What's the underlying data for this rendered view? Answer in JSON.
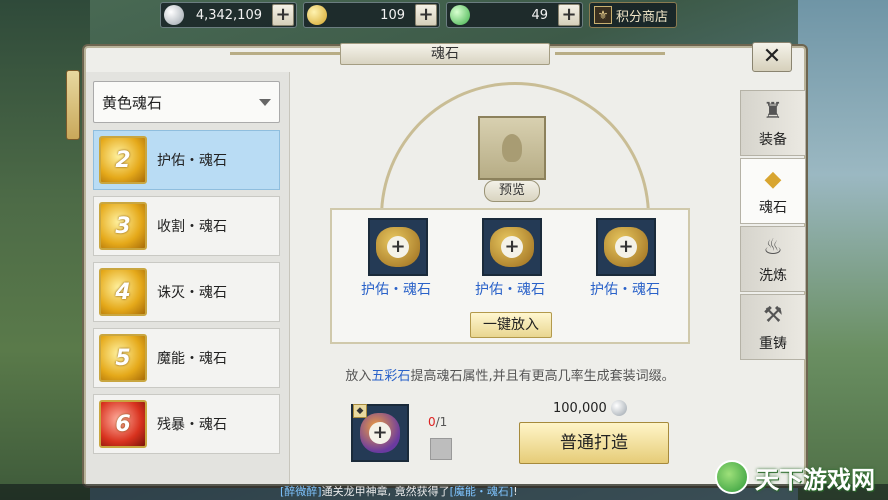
{
  "resources": [
    {
      "icon": "silver-coin-icon",
      "value": "4,342,109"
    },
    {
      "icon": "gold-coin-icon",
      "value": "109"
    },
    {
      "icon": "jade-icon",
      "value": "49"
    }
  ],
  "shop": {
    "label": "积分商店"
  },
  "panel": {
    "title": "魂石",
    "close": "✕"
  },
  "dropdown": {
    "selected": "黄色魂石"
  },
  "stone_list": [
    {
      "num": "2",
      "name": "护佑・魂石",
      "color": "yellow"
    },
    {
      "num": "3",
      "name": "收割・魂石",
      "color": "yellow"
    },
    {
      "num": "4",
      "name": "诛灭・魂石",
      "color": "yellow"
    },
    {
      "num": "5",
      "name": "魔能・魂石",
      "color": "yellow"
    },
    {
      "num": "6",
      "name": "残暴・魂石",
      "color": "red"
    }
  ],
  "tabs": [
    {
      "label": "装备",
      "icon": "armor-icon"
    },
    {
      "label": "魂石",
      "icon": "soulstone-icon"
    },
    {
      "label": "洗炼",
      "icon": "cauldron-icon"
    },
    {
      "label": "重铸",
      "icon": "anvil-icon"
    }
  ],
  "preview": {
    "label": "预览"
  },
  "slots": [
    {
      "label": "护佑・魂石"
    },
    {
      "label": "护佑・魂石"
    },
    {
      "label": "护佑・魂石"
    }
  ],
  "one_key_button": "一键放入",
  "hint": {
    "prefix": "放入",
    "highlight": "五彩石",
    "suffix": "提高魂石属性,并且有更高几率生成套装词缀。"
  },
  "bottom": {
    "count_have": "0",
    "count_sep": "/1",
    "cost": "100,000",
    "forge_button": "普通打造"
  },
  "chat": {
    "sender": "[醉微醉]",
    "text1": "通关龙甲神章, 竟然获得了",
    "item": "[魔能・魂石]",
    "text2": "!"
  },
  "watermark": {
    "text": "天下游戏网"
  }
}
